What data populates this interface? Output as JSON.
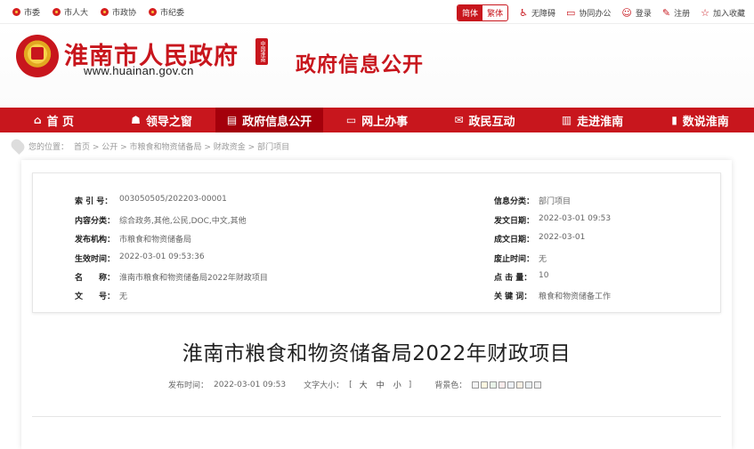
{
  "topbar": {
    "links": [
      "市委",
      "市人大",
      "市政协",
      "市纪委"
    ],
    "lang_simplified": "简体",
    "lang_traditional": "繁体",
    "accessibility": "无障碍",
    "office": "协同办公",
    "login": "登录",
    "register": "注册",
    "favorite": "加入收藏"
  },
  "header": {
    "title": "淮南市人民政府",
    "url": "www.huainan.gov.cn",
    "seal_text": "中国淮南",
    "section": "政府信息公开"
  },
  "nav": {
    "items": [
      {
        "label": "首 页",
        "icon": "⌂"
      },
      {
        "label": "领导之窗",
        "icon": "☗"
      },
      {
        "label": "政府信息公开",
        "icon": "▤"
      },
      {
        "label": "网上办事",
        "icon": "▭"
      },
      {
        "label": "政民互动",
        "icon": "✉"
      },
      {
        "label": "走进淮南",
        "icon": "▥"
      },
      {
        "label": "数说淮南",
        "icon": "▮"
      }
    ],
    "active_index": 2
  },
  "breadcrumb": {
    "prefix": "您的位置：",
    "path": "首页 > 公开 > 市粮食和物资储备局 > 财政资金 > 部门项目"
  },
  "info": {
    "left": [
      {
        "k": "索 引 号：",
        "v": "003050505/202203-00001"
      },
      {
        "k": "内容分类：",
        "v": "综合政务,其他,公民,DOC,中文,其他"
      },
      {
        "k": "发布机构：",
        "v": "市粮食和物资储备局"
      },
      {
        "k": "生效时间：",
        "v": "2022-03-01 09:53:36"
      },
      {
        "k": "名　　称：",
        "v": "淮南市粮食和物资储备局2022年财政项目"
      },
      {
        "k": "文　　号：",
        "v": "无"
      }
    ],
    "right": [
      {
        "k": "信息分类：",
        "v": "部门项目"
      },
      {
        "k": "发文日期：",
        "v": "2022-03-01 09:53"
      },
      {
        "k": "成文日期：",
        "v": "2022-03-01"
      },
      {
        "k": "废止时间：",
        "v": "无"
      },
      {
        "k": "点 击 量：",
        "v": "10"
      },
      {
        "k": "关 键 词：",
        "v": "粮食和物资储备工作"
      }
    ]
  },
  "article": {
    "title": "淮南市粮食和物资储备局2022年财政项目",
    "publish_label": "发布时间：",
    "publish_time": "2022-03-01 09:53",
    "font_label": "文字大小：",
    "open_bracket": "[",
    "close_bracket": "]",
    "size_large": "大",
    "size_medium": "中",
    "size_small": "小",
    "bg_label": "背景色：",
    "bg_colors": [
      "#f4f4f4",
      "#fff7e0",
      "#e8f3e8",
      "#fbecec",
      "#eef2f8",
      "#f8f0e4",
      "#e9eef0",
      "#f0f0f0"
    ]
  },
  "colors": {
    "brand": "#c8161d",
    "nav_active": "#a4000b"
  }
}
